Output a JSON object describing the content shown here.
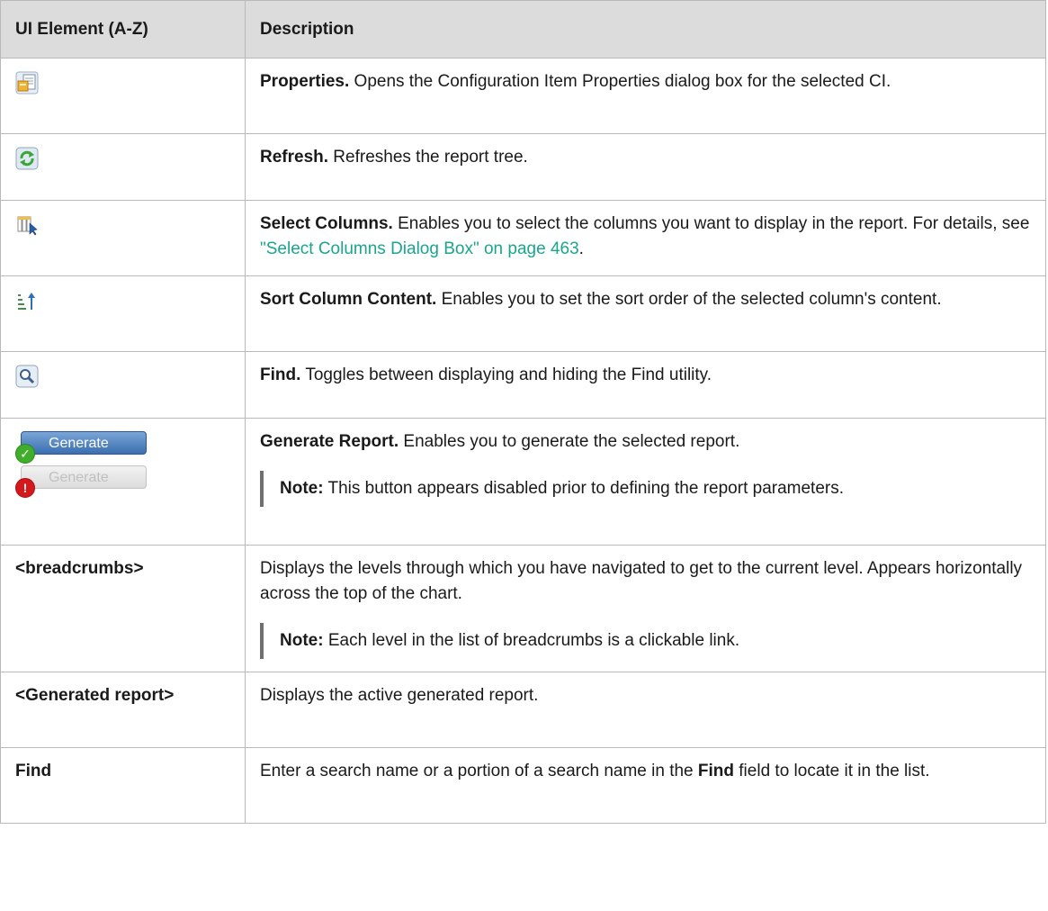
{
  "table": {
    "headers": [
      "UI Element (A-Z)",
      "Description"
    ],
    "rows": [
      {
        "element_icon": "properties-icon",
        "title": "Properties.",
        "text": " Opens the Configuration Item Properties dialog box for the selected CI."
      },
      {
        "element_icon": "refresh-icon",
        "title": "Refresh.",
        "text": " Refreshes the report tree."
      },
      {
        "element_icon": "select-columns-icon",
        "title": "Select Columns.",
        "text_before": " Enables you to select the columns you want to display in the report. For details, see ",
        "link": "\"Select Columns Dialog Box\" on page 463",
        "text_after": "."
      },
      {
        "element_icon": "sort-ascending-icon",
        "title": "Sort Column Content.",
        "text": " Enables you to set the sort order of the selected column's content."
      },
      {
        "element_icon": "find-icon",
        "title": "Find.",
        "text": " Toggles between displaying and hiding the Find utility."
      },
      {
        "element_buttons": [
          "Generate",
          "Generate"
        ],
        "title": "Generate Report.",
        "text": " Enables you to generate the selected report.",
        "note_label": "Note:",
        "note_text": "  This button appears disabled prior to defining the report parameters."
      },
      {
        "element": "<breadcrumbs>",
        "text": "Displays the levels through which you have navigated to get to the current level. Appears horizontally across the top of the chart.",
        "note_label": "Note:",
        "note_text": "  Each level in the list of breadcrumbs is a clickable link."
      },
      {
        "element": "<Generated report>",
        "text": "Displays the active generated report."
      },
      {
        "element": "Find",
        "text_before": "Enter a search name or a portion of a search name in the ",
        "bold": "Find",
        "text_after": " field to locate it in the list."
      }
    ]
  },
  "colors": {
    "header_bg": "#dcdcdc",
    "border": "#b9b9b9",
    "link": "#1aa68c",
    "note_bar": "#6f6f6f"
  }
}
